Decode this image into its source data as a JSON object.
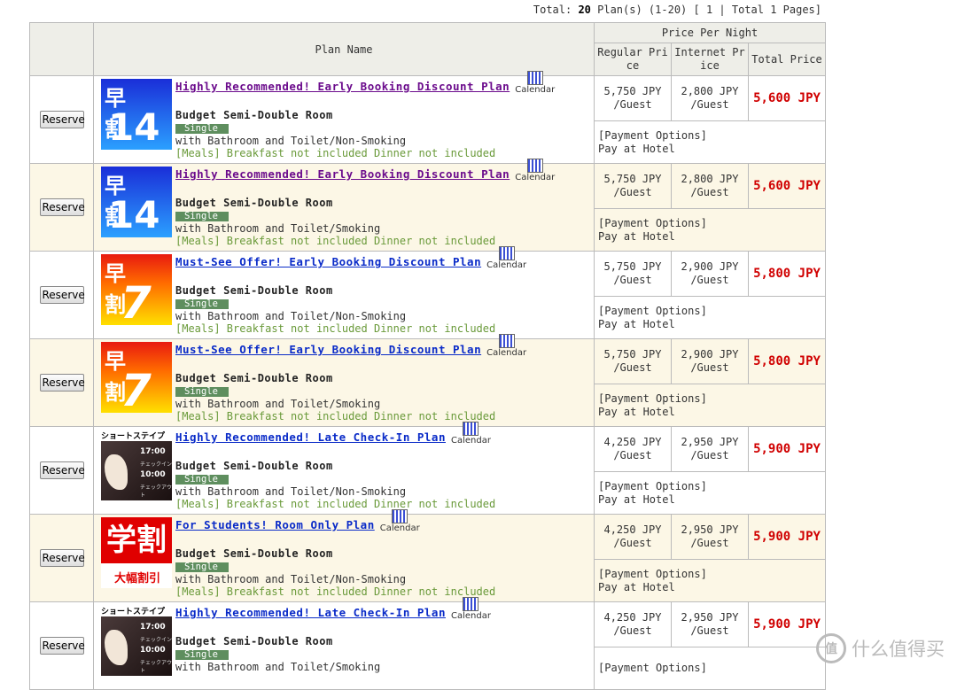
{
  "summary": {
    "prefix": "Total: ",
    "count": "20",
    "suffix": " Plan(s) (1-20) [ 1 | Total 1 Pages]"
  },
  "headers": {
    "blank": "",
    "plan_name": "Plan Name",
    "price_per_night": "Price Per Night",
    "regular": "Regular Price",
    "internet": "Internet Price",
    "total": "Total Price"
  },
  "reserve_label": "Reserve",
  "calendar_label": "Calendar",
  "plans": [
    {
      "thumb": "早割14",
      "thumb_kana": "早 割",
      "thumb_num": "14",
      "name": "Highly Recommended! Early Booking Discount Plan",
      "room": "Budget Semi-Double Room",
      "tag": "Single",
      "bath": "with Bathroom and Toilet/Non-Smoking",
      "meals": "[Meals] Breakfast not included Dinner not included",
      "regular": "5,750 JPY",
      "regular_unit": "/Guest",
      "internet": "2,800 JPY",
      "internet_unit": "/Guest",
      "total": "5,600 JPY",
      "payment_label": "[Payment Options]",
      "payment": "Pay at Hotel"
    },
    {
      "thumb": "早割14",
      "thumb_kana": "早 割",
      "thumb_num": "14",
      "name": "Highly Recommended! Early Booking Discount Plan",
      "room": "Budget Semi-Double Room",
      "tag": "Single",
      "bath": "with Bathroom and Toilet/Smoking",
      "meals": "[Meals] Breakfast not included Dinner not included",
      "regular": "5,750 JPY",
      "regular_unit": "/Guest",
      "internet": "2,800 JPY",
      "internet_unit": "/Guest",
      "total": "5,600 JPY",
      "payment_label": "[Payment Options]",
      "payment": "Pay at Hotel"
    },
    {
      "thumb": "早割7",
      "thumb_kana": "早 割",
      "thumb_num": "7",
      "name": "Must-See Offer! Early Booking Discount Plan",
      "room": "Budget Semi-Double Room",
      "tag": "Single",
      "bath": "with Bathroom and Toilet/Non-Smoking",
      "meals": "[Meals] Breakfast not included Dinner not included",
      "regular": "5,750 JPY",
      "regular_unit": "/Guest",
      "internet": "2,900 JPY",
      "internet_unit": "/Guest",
      "total": "5,800 JPY",
      "payment_label": "[Payment Options]",
      "payment": "Pay at Hotel"
    },
    {
      "thumb": "早割7",
      "thumb_kana": "早 割",
      "thumb_num": "7",
      "name": "Must-See Offer! Early Booking Discount Plan",
      "room": "Budget Semi-Double Room",
      "tag": "Single",
      "bath": "with Bathroom and Toilet/Smoking",
      "meals": "[Meals] Breakfast not included Dinner not included",
      "regular": "5,750 JPY",
      "regular_unit": "/Guest",
      "internet": "2,900 JPY",
      "internet_unit": "/Guest",
      "total": "5,800 JPY",
      "payment_label": "[Payment Options]",
      "payment": "Pay at Hotel"
    },
    {
      "thumb": "ショートステイプラン",
      "thumb_in": "17:00",
      "thumb_in_label": "チェックイン",
      "thumb_out": "10:00",
      "thumb_out_label": "チェックアウト",
      "name": "Highly Recommended! Late Check-In Plan",
      "room": "Budget Semi-Double Room",
      "tag": "Single",
      "bath": "with Bathroom and Toilet/Non-Smoking",
      "meals": "[Meals] Breakfast not included Dinner not included",
      "regular": "4,250 JPY",
      "regular_unit": "/Guest",
      "internet": "2,950 JPY",
      "internet_unit": "/Guest",
      "total": "5,900 JPY",
      "payment_label": "[Payment Options]",
      "payment": "Pay at Hotel"
    },
    {
      "thumb": "学割",
      "thumb_sub": "大幅割引",
      "name": "For Students! Room Only Plan",
      "room": "Budget Semi-Double Room",
      "tag": "Single",
      "bath": "with Bathroom and Toilet/Non-Smoking",
      "meals": "[Meals] Breakfast not included Dinner not included",
      "regular": "4,250 JPY",
      "regular_unit": "/Guest",
      "internet": "2,950 JPY",
      "internet_unit": "/Guest",
      "total": "5,900 JPY",
      "payment_label": "[Payment Options]",
      "payment": "Pay at Hotel"
    },
    {
      "thumb": "ショートステイプラン",
      "thumb_in": "17:00",
      "thumb_in_label": "チェックイン",
      "thumb_out": "10:00",
      "thumb_out_label": "チェックアウト",
      "name": "Highly Recommended! Late Check-In Plan",
      "room": "Budget Semi-Double Room",
      "tag": "Single",
      "bath": "with Bathroom and Toilet/Smoking",
      "meals": "",
      "regular": "4,250 JPY",
      "regular_unit": "/Guest",
      "internet": "2,950 JPY",
      "internet_unit": "/Guest",
      "total": "5,900 JPY",
      "payment_label": "[Payment Options]",
      "payment": ""
    }
  ],
  "watermark": {
    "logo": "值",
    "text": "什么值得买"
  }
}
